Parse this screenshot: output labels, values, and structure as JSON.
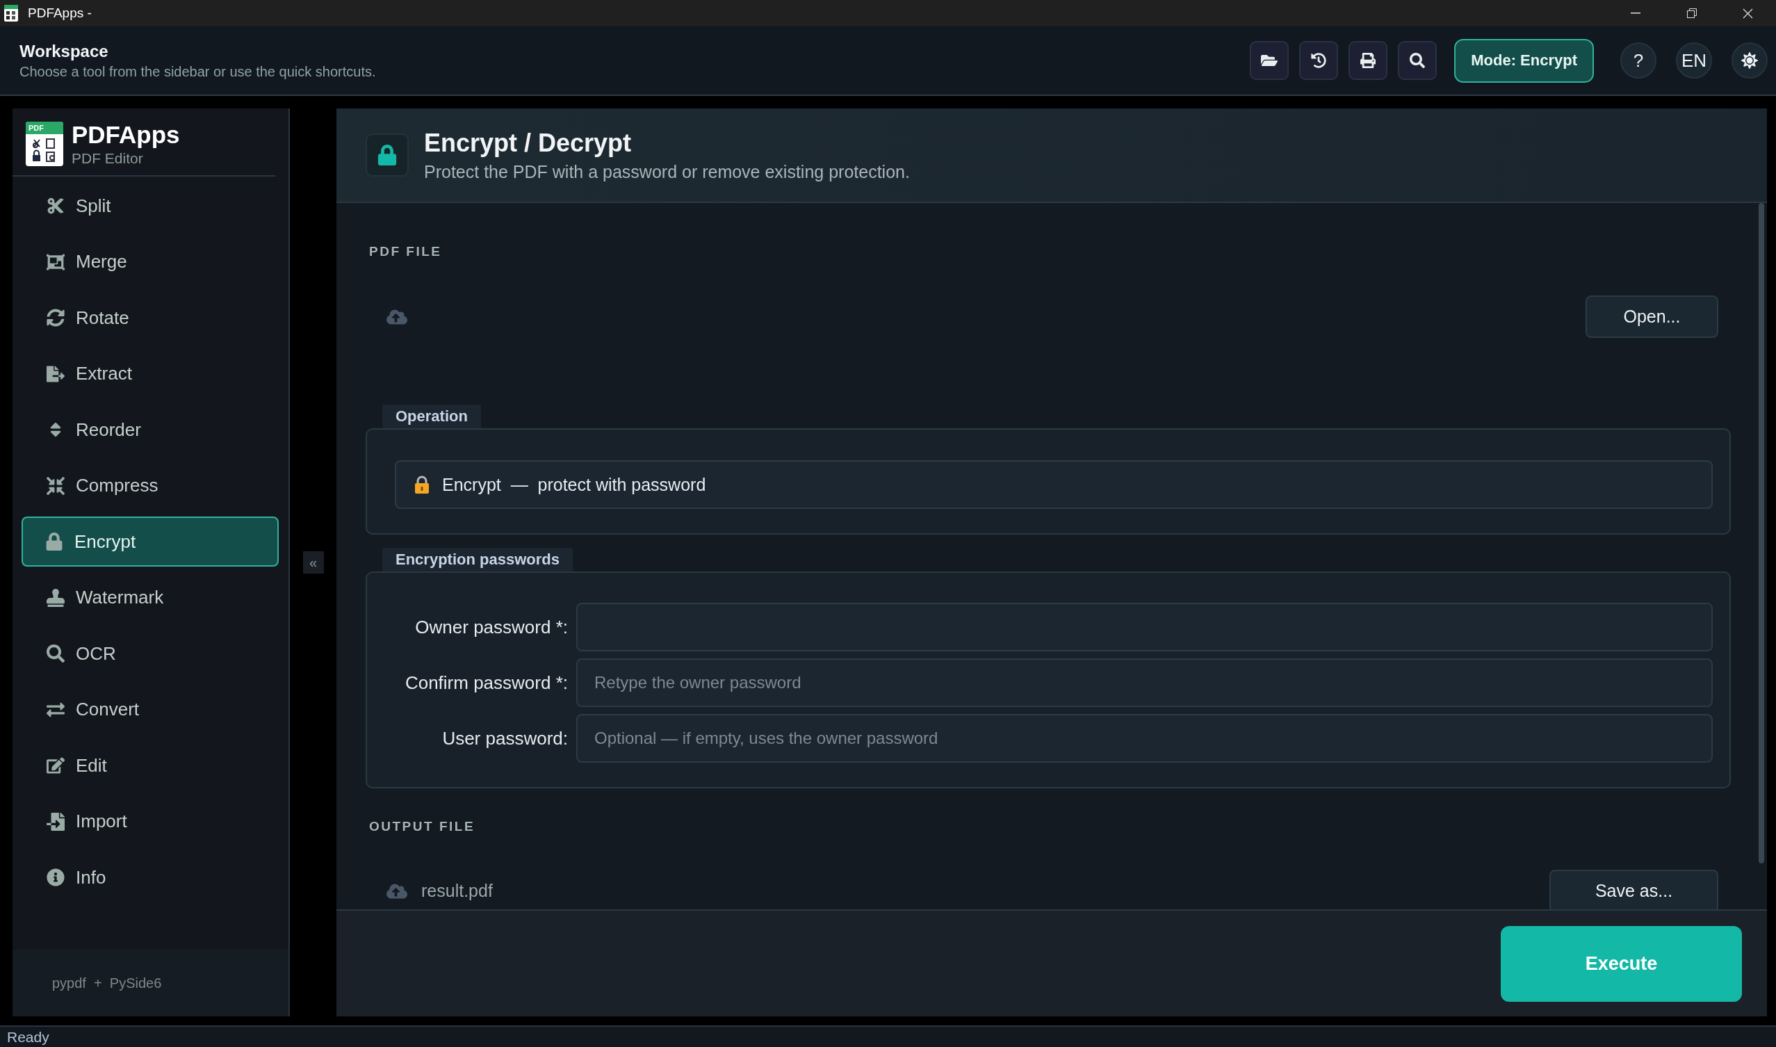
{
  "window": {
    "title": "PDFApps -"
  },
  "header": {
    "title": "Workspace",
    "subtitle": "Choose a tool from the sidebar or use the quick shortcuts."
  },
  "toolbar": {
    "mode_button": "Mode: Encrypt",
    "help_button": "?",
    "language_button": "EN"
  },
  "sidebar": {
    "logo_label": "PDF",
    "app_name": "PDFApps",
    "app_subtitle": "PDF Editor",
    "items": [
      {
        "label": "Split",
        "selected": false
      },
      {
        "label": "Merge",
        "selected": false
      },
      {
        "label": "Rotate",
        "selected": false
      },
      {
        "label": "Extract",
        "selected": false
      },
      {
        "label": "Reorder",
        "selected": false
      },
      {
        "label": "Compress",
        "selected": false
      },
      {
        "label": "Encrypt",
        "selected": true
      },
      {
        "label": "Watermark",
        "selected": false
      },
      {
        "label": "OCR",
        "selected": false
      },
      {
        "label": "Convert",
        "selected": false
      },
      {
        "label": "Edit",
        "selected": false
      },
      {
        "label": "Import",
        "selected": false
      },
      {
        "label": "Info",
        "selected": false
      }
    ],
    "footer": "pypdf  +  PySide6"
  },
  "collapse_button": "«",
  "tool": {
    "title": "Encrypt / Decrypt",
    "description": "Protect the PDF with a password or remove existing protection."
  },
  "pdf_file": {
    "heading": "PDF FILE",
    "open_button": "Open..."
  },
  "operation": {
    "heading": "Operation",
    "value": "Encrypt  —  protect with password"
  },
  "passwords": {
    "heading": "Encryption passwords",
    "fields": [
      {
        "label": "Owner password *:"
      },
      {
        "label": "Confirm password *:",
        "placeholder": "Retype the owner password"
      },
      {
        "label": "User password:",
        "placeholder": "Optional — if empty, uses the owner password"
      }
    ]
  },
  "output_file": {
    "heading": "OUTPUT FILE",
    "filename": "result.pdf",
    "save_button": "Save as..."
  },
  "execute_button": "Execute",
  "status_bar": "Ready"
}
